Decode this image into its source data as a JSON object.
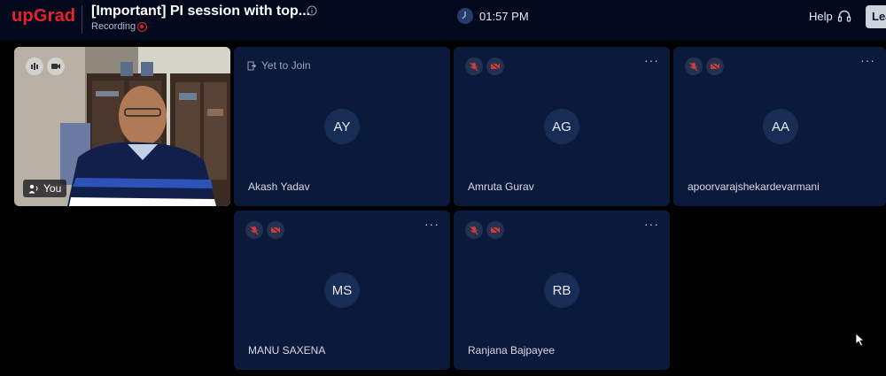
{
  "header": {
    "logo": "upGrad",
    "title": "[Important] PI session with top...",
    "recording_label": "Recording",
    "time": "01:57 PM",
    "help_label": "Help",
    "leave_label": "Leave"
  },
  "self_tile": {
    "label": "You"
  },
  "participants": [
    {
      "initials": "AY",
      "name": "Akash Yadav",
      "status": "Yet to Join"
    },
    {
      "initials": "AG",
      "name": "Amruta Gurav"
    },
    {
      "initials": "AA",
      "name": "apoorvarajshekardevarmani"
    },
    {
      "initials": "MS",
      "name": "MANU SAXENA"
    },
    {
      "initials": "RB",
      "name": "Ranjana Bajpayee"
    }
  ],
  "more_symbol": "···",
  "colors": {
    "brand": "#e8222b",
    "background": "#000000",
    "header": "#03091c",
    "tile": "#0b1a3a",
    "avatar": "#182d55",
    "muted_red": "#d23b3b"
  },
  "icons": [
    "info-icon",
    "recording-icon",
    "clock-icon",
    "headset-icon",
    "audio-level-icon",
    "camera-icon",
    "speaker-user-icon",
    "door-exit-icon",
    "mic-off-icon",
    "camera-off-icon",
    "more-options-icon",
    "mouse-cursor-icon"
  ]
}
